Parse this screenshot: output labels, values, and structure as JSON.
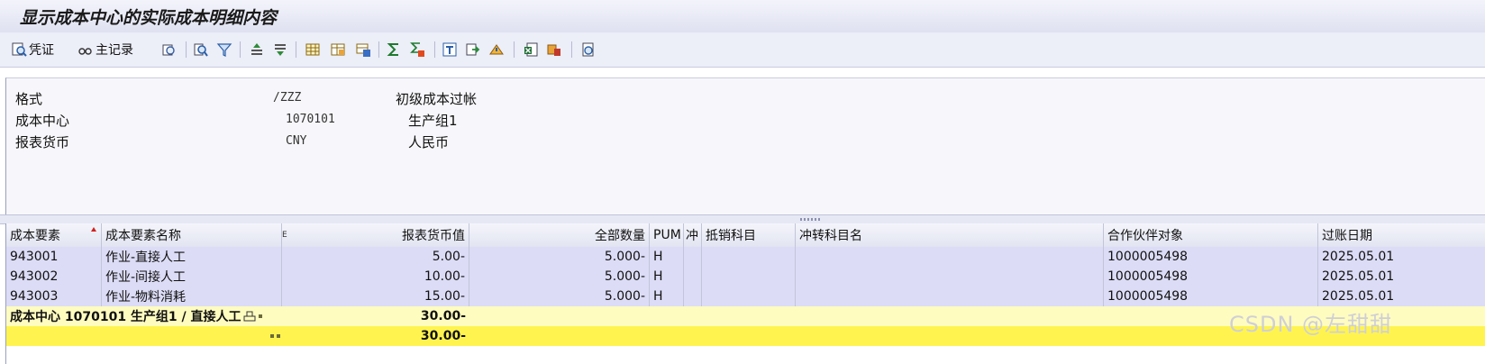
{
  "window": {
    "title": "显示成本中心的实际成本明细内容"
  },
  "toolbar": {
    "voucher_label": "凭证",
    "master_record_label": "主记录",
    "icons": [
      "detail-icon",
      "find-icon",
      "filter-icon",
      "sort-ascending-icon",
      "sort-descending-icon",
      "layout-icon",
      "choose-layout-icon",
      "save-layout-icon",
      "sum-icon",
      "subtotal-icon",
      "print-preview-icon",
      "export-icon",
      "send-icon",
      "spreadsheet-icon",
      "graphics-icon",
      "info-icon"
    ]
  },
  "header": {
    "rows": [
      {
        "label": "格式",
        "code": "/ZZZ",
        "text": "初级成本过帐"
      },
      {
        "label": "成本中心",
        "code": "1070101",
        "text": "生产组1"
      },
      {
        "label": "报表货币",
        "code": "CNY",
        "text": "人民币"
      }
    ]
  },
  "grid": {
    "columns": [
      "成本要素",
      "成本要素名称",
      "报表货币值",
      "全部数量",
      "PUM",
      "冲",
      "抵销科目",
      "冲转科目名",
      "合作伙伴对象",
      "过账日期"
    ],
    "sum_marker": "E",
    "rows": [
      [
        "943001",
        "作业-直接人工",
        "5.00-",
        "5.000-",
        "H",
        "",
        "",
        "",
        "1000005498",
        "2025.05.01"
      ],
      [
        "943002",
        "作业-间接人工",
        "10.00-",
        "5.000-",
        "H",
        "",
        "",
        "",
        "1000005498",
        "2025.05.01"
      ],
      [
        "943003",
        "作业-物料消耗",
        "15.00-",
        "5.000-",
        "H",
        "",
        "",
        "",
        "1000005498",
        "2025.05.01"
      ]
    ],
    "subtotal": {
      "label": "成本中心 1070101 生产组1 / 直接人工",
      "value": "30.00-"
    },
    "total": {
      "value": "30.00-"
    }
  },
  "watermark": "CSDN @左甜甜"
}
